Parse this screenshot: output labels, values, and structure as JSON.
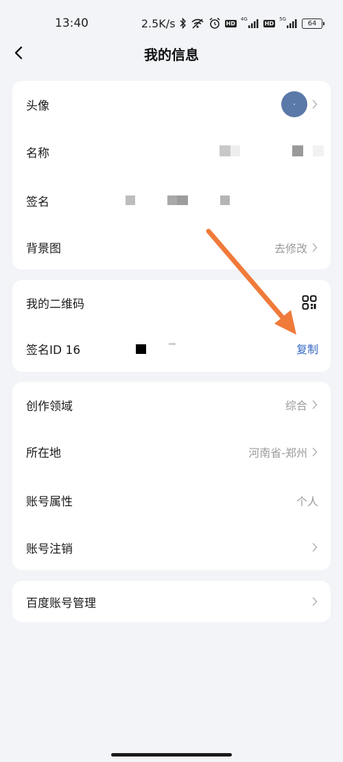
{
  "status_bar": {
    "time": "13:40",
    "speed": "2.5K/s",
    "network_1": "4G",
    "network_2": "5G",
    "battery": "64",
    "icons": [
      "bluetooth-icon",
      "wifi-off-icon",
      "alarm-icon",
      "hd-badge",
      "signal-icon",
      "hd-badge",
      "signal-icon",
      "battery-icon"
    ]
  },
  "header": {
    "title": "我的信息"
  },
  "profile_card": {
    "avatar_label": "头像",
    "name_label": "名称",
    "signature_label": "签名",
    "background_label": "背景图",
    "background_value": "去修改"
  },
  "qr_card": {
    "qr_label": "我的二维码",
    "id_label": "签名ID 16",
    "copy_label": "复制"
  },
  "info_card": {
    "field_label": "创作领域",
    "field_value": "综合",
    "location_label": "所在地",
    "location_value": "河南省-郑州",
    "account_type_label": "账号属性",
    "account_type_value": "个人",
    "cancel_label": "账号注销"
  },
  "baidu_card": {
    "label": "百度账号管理"
  },
  "colors": {
    "background": "#f2f4f8",
    "card": "#ffffff",
    "link": "#3566c4",
    "annotation_arrow": "#f07a3a",
    "avatar": "#5a79a8"
  }
}
